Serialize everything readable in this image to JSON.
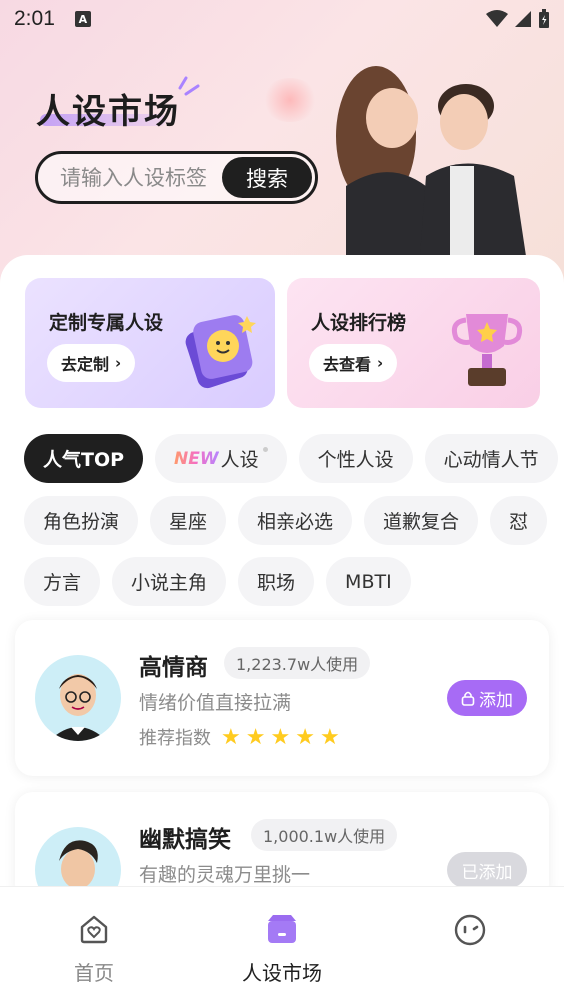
{
  "status_bar": {
    "time": "2:01",
    "app_badge": "A"
  },
  "header": {
    "title": "人设市场"
  },
  "search": {
    "placeholder": "请输入人设标签",
    "button_label": "搜索"
  },
  "promo_cards": [
    {
      "title": "定制专属人设",
      "button_label": "去定制"
    },
    {
      "title": "人设排行榜",
      "button_label": "去查看"
    }
  ],
  "tags": {
    "row1": [
      "人气TOP",
      "人设",
      "个性人设",
      "心动情人节"
    ],
    "row1_new_prefix": "NEW",
    "row2": [
      "角色扮演",
      "星座",
      "相亲必选",
      "道歉复合",
      "怼"
    ],
    "row3": [
      "方言",
      "小说主角",
      "职场",
      "MBTI"
    ],
    "active": "人气TOP"
  },
  "personas": [
    {
      "name": "高情商",
      "usage": "1,223.7w人使用",
      "description": "情绪价值直接拉满",
      "rating_label": "推荐指数",
      "stars": 5,
      "add_label": "添加",
      "add_state": "available"
    },
    {
      "name": "幽默搞笑",
      "usage": "1,000.1w人使用",
      "description": "有趣的灵魂万里挑一",
      "add_label": "已添加",
      "add_state": "added"
    }
  ],
  "tab_bar": {
    "items": [
      {
        "label": "首页",
        "icon": "home-heart-icon"
      },
      {
        "label": "人设市场",
        "icon": "market-icon"
      },
      {
        "label": "",
        "icon": "face-icon"
      }
    ],
    "active_index": 1
  },
  "colors": {
    "accent_purple": "#a76bf5",
    "star_yellow": "#ffcb1f",
    "dark": "#1f1f1f"
  }
}
